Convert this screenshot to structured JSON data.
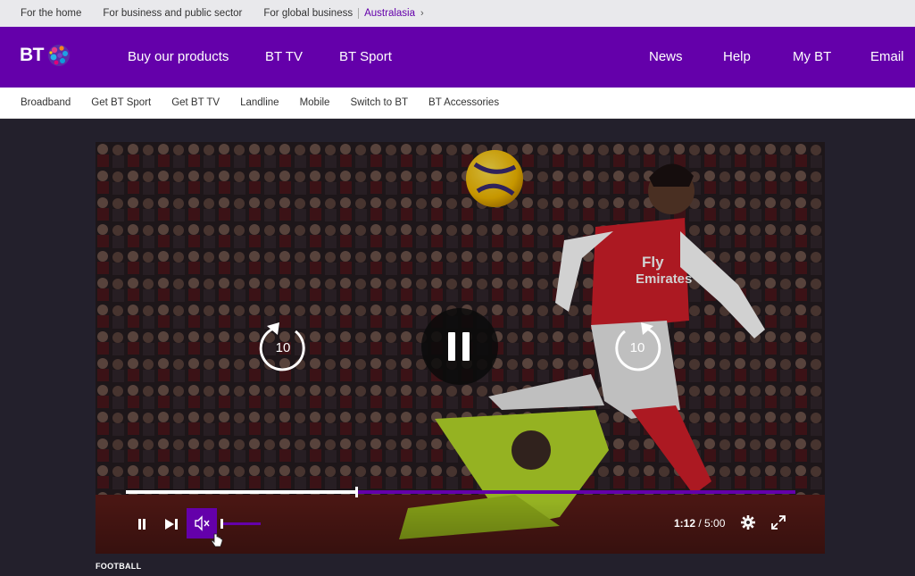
{
  "utility_bar": {
    "links": [
      "For the home",
      "For business and public sector",
      "For global business"
    ],
    "region": "Australasia"
  },
  "brand": {
    "logo_text": "BT"
  },
  "main_nav": {
    "left": [
      "Buy our products",
      "BT TV",
      "BT Sport"
    ],
    "right": [
      "News",
      "Help",
      "My BT",
      "Email"
    ]
  },
  "sub_nav": [
    "Broadband",
    "Get BT Sport",
    "Get BT TV",
    "Landline",
    "Mobile",
    "Switch to BT",
    "BT Accessories"
  ],
  "player": {
    "skip_back_seconds": "10",
    "skip_forward_seconds": "10",
    "current_time": "1:12",
    "separator": " / ",
    "duration": "5:00",
    "progress": 0.344,
    "volume": 0.0,
    "muted": true
  },
  "colors": {
    "brand_purple": "#6400aa",
    "page_bg": "#23202c"
  },
  "article": {
    "category": "FOOTBALL"
  }
}
